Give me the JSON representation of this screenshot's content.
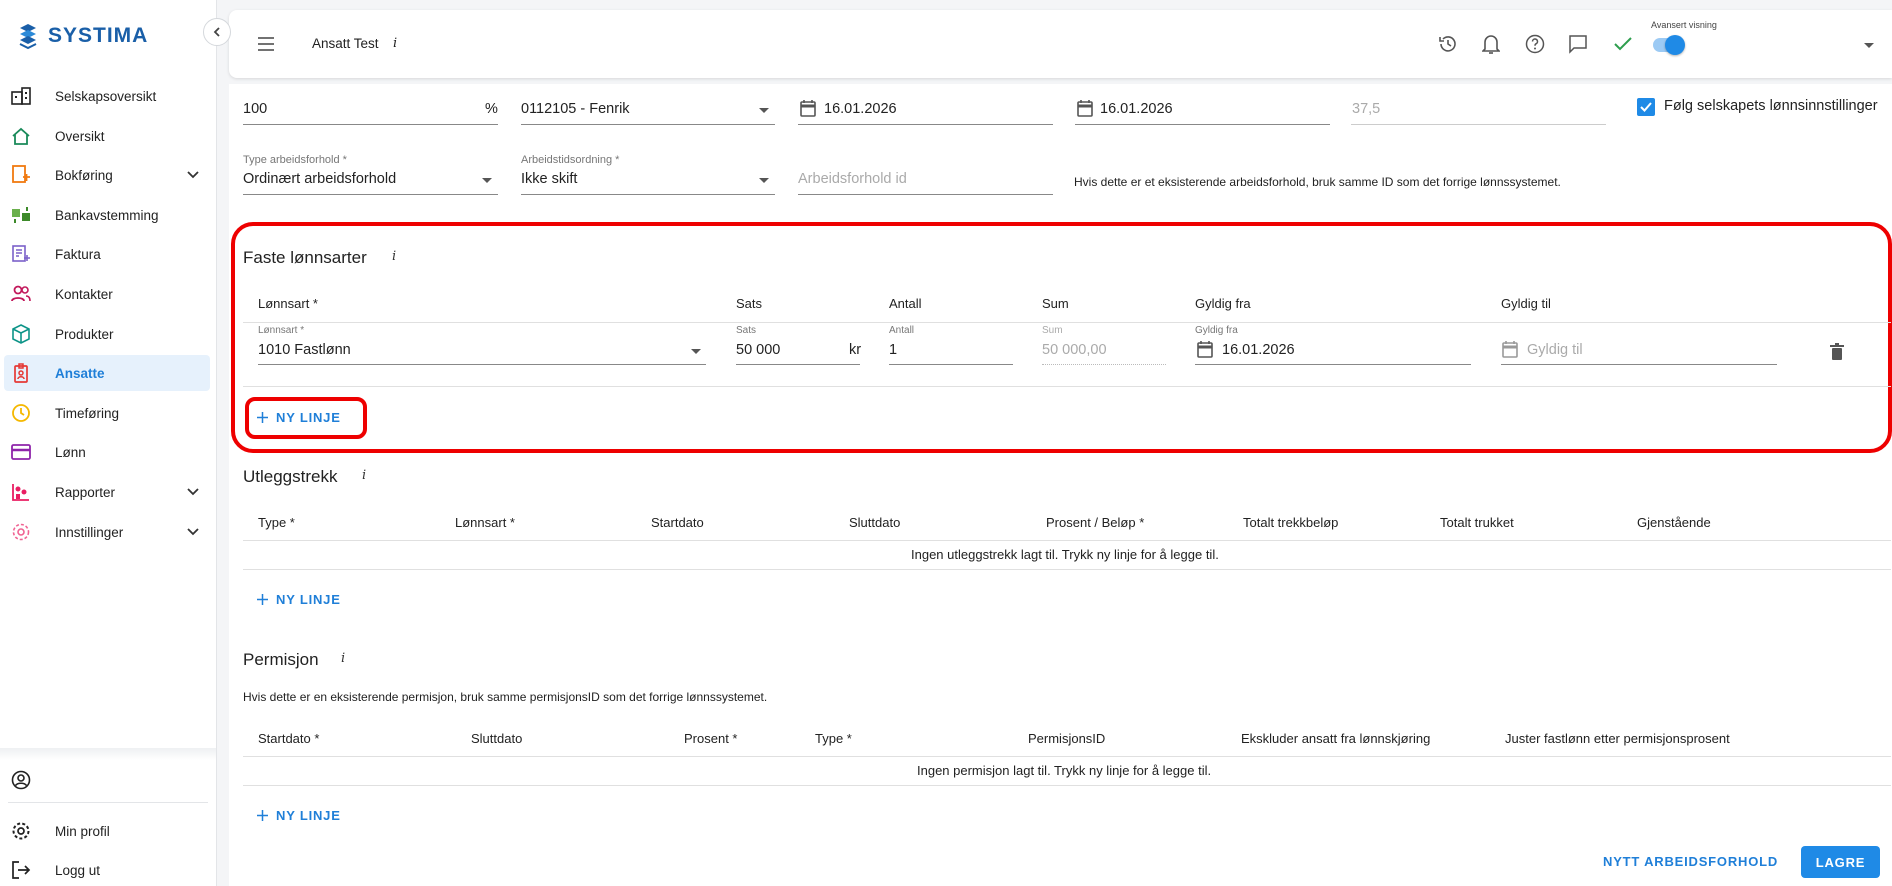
{
  "brand": {
    "name": "SYSTIMA"
  },
  "sidebar": {
    "items": [
      {
        "label": "Selskapsoversikt",
        "icon": "company-overview-icon"
      },
      {
        "label": "Oversikt",
        "icon": "home-icon"
      },
      {
        "label": "Bokføring",
        "icon": "bookkeeping-icon"
      },
      {
        "label": "Bankavstemming",
        "icon": "bank-reconciliation-icon"
      },
      {
        "label": "Faktura",
        "icon": "invoice-icon"
      },
      {
        "label": "Kontakter",
        "icon": "contacts-icon"
      },
      {
        "label": "Produkter",
        "icon": "products-icon"
      },
      {
        "label": "Ansatte",
        "icon": "employees-icon"
      },
      {
        "label": "Timeføring",
        "icon": "clock-icon"
      },
      {
        "label": "Lønn",
        "icon": "payroll-icon"
      },
      {
        "label": "Rapporter",
        "icon": "reports-icon"
      },
      {
        "label": "Innstillinger",
        "icon": "settings-icon"
      }
    ],
    "bottom": {
      "profile_label": "Min profil",
      "logout_label": "Logg ut"
    }
  },
  "topbar": {
    "title": "Ansatt Test",
    "info": "i",
    "toggle_label": "Avansert visning"
  },
  "employment": {
    "stillingsprosent": {
      "value": "100",
      "unit": "%"
    },
    "yrkeskode": {
      "value": "0112105 - Fenrik"
    },
    "dato1": {
      "value": "16.01.2026"
    },
    "dato2": {
      "value": "16.01.2026"
    },
    "timer": {
      "value": "37,5"
    },
    "follow_settings": {
      "label": "Følg selskapets lønnsinnstillinger",
      "checked": true
    },
    "type": {
      "label": "Type arbeidsforhold *",
      "value": "Ordinært arbeidsforhold"
    },
    "ordning": {
      "label": "Arbeidstidsordning *",
      "value": "Ikke skift"
    },
    "arbeidsforhold_id": {
      "placeholder": "Arbeidsforhold id"
    },
    "id_hint": "Hvis dette er et eksisterende arbeidsforhold, bruk samme ID som det forrige lønnssystemet."
  },
  "faste": {
    "title": "Faste lønnsarter",
    "info": "i",
    "headers": [
      "Lønnsart *",
      "Sats",
      "Antall",
      "Sum",
      "Gyldig fra",
      "Gyldig til"
    ],
    "row": {
      "lonnsart_label": "Lønnsart *",
      "lonnsart": "1010 Fastlønn",
      "sats_label": "Sats",
      "sats": "50 000",
      "sats_unit": "kr",
      "antall_label": "Antall",
      "antall": "1",
      "sum_label": "Sum",
      "sum": "50 000,00",
      "fra_label": "Gyldig fra",
      "fra": "16.01.2026",
      "til_placeholder": "Gyldig til"
    },
    "add_label": "NY LINJE"
  },
  "utlegg": {
    "title": "Utleggstrekk",
    "info": "i",
    "headers": [
      "Type *",
      "Lønnsart *",
      "Startdato",
      "Sluttdato",
      "Prosent / Beløp *",
      "Totalt trekkbeløp",
      "Totalt trukket",
      "Gjenstående"
    ],
    "empty": "Ingen utleggstrekk lagt til. Trykk ny linje for å legge til.",
    "add_label": "NY LINJE"
  },
  "permisjon": {
    "title": "Permisjon",
    "info": "i",
    "hint": "Hvis dette er en eksisterende permisjon, bruk samme permisjonsID som det forrige lønnssystemet.",
    "headers": [
      "Startdato *",
      "Sluttdato",
      "Prosent *",
      "Type *",
      "PermisjonsID",
      "Ekskluder ansatt fra lønnskjøring",
      "Juster fastlønn etter permisjonsprosent"
    ],
    "empty": "Ingen permisjon lagt til. Trykk ny linje for å legge til.",
    "add_label": "NY LINJE"
  },
  "footer": {
    "new_label": "NYTT ARBEIDSFORHOLD",
    "save_label": "LAGRE"
  },
  "colors": {
    "accent": "#1f8ae6",
    "highlight": "#e00000"
  }
}
